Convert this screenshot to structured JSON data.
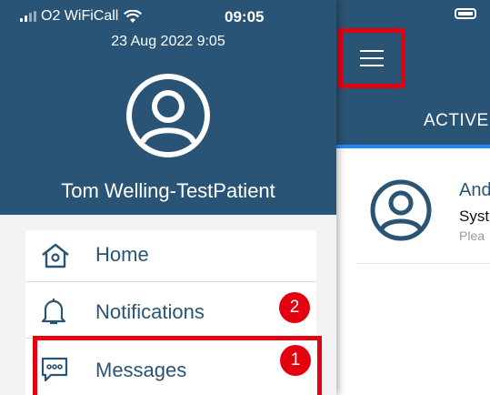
{
  "status_bar": {
    "carrier": "O2 WiFiCall",
    "time": "09:05"
  },
  "drawer": {
    "datetime": "23 Aug 2022 9:05",
    "patient_name": "Tom Welling-TestPatient",
    "avatar_icon": "user-circle-icon",
    "menu": [
      {
        "label": "Home",
        "icon": "home-icon"
      },
      {
        "label": "Notifications",
        "icon": "bell-icon",
        "badge": "2"
      },
      {
        "label": "Messages",
        "icon": "message-bubble-icon",
        "badge": "1"
      }
    ]
  },
  "main": {
    "menu_icon": "hamburger-menu-icon",
    "tab_label": "ACTIVE",
    "message": {
      "name_partial": "And",
      "type_partial": "Syst",
      "preview_partial": "Plea"
    }
  },
  "colors": {
    "header": "#2a5475",
    "highlight": "#e3000f",
    "tab_indicator": "#1d8bff",
    "badge": "#e3000f"
  }
}
